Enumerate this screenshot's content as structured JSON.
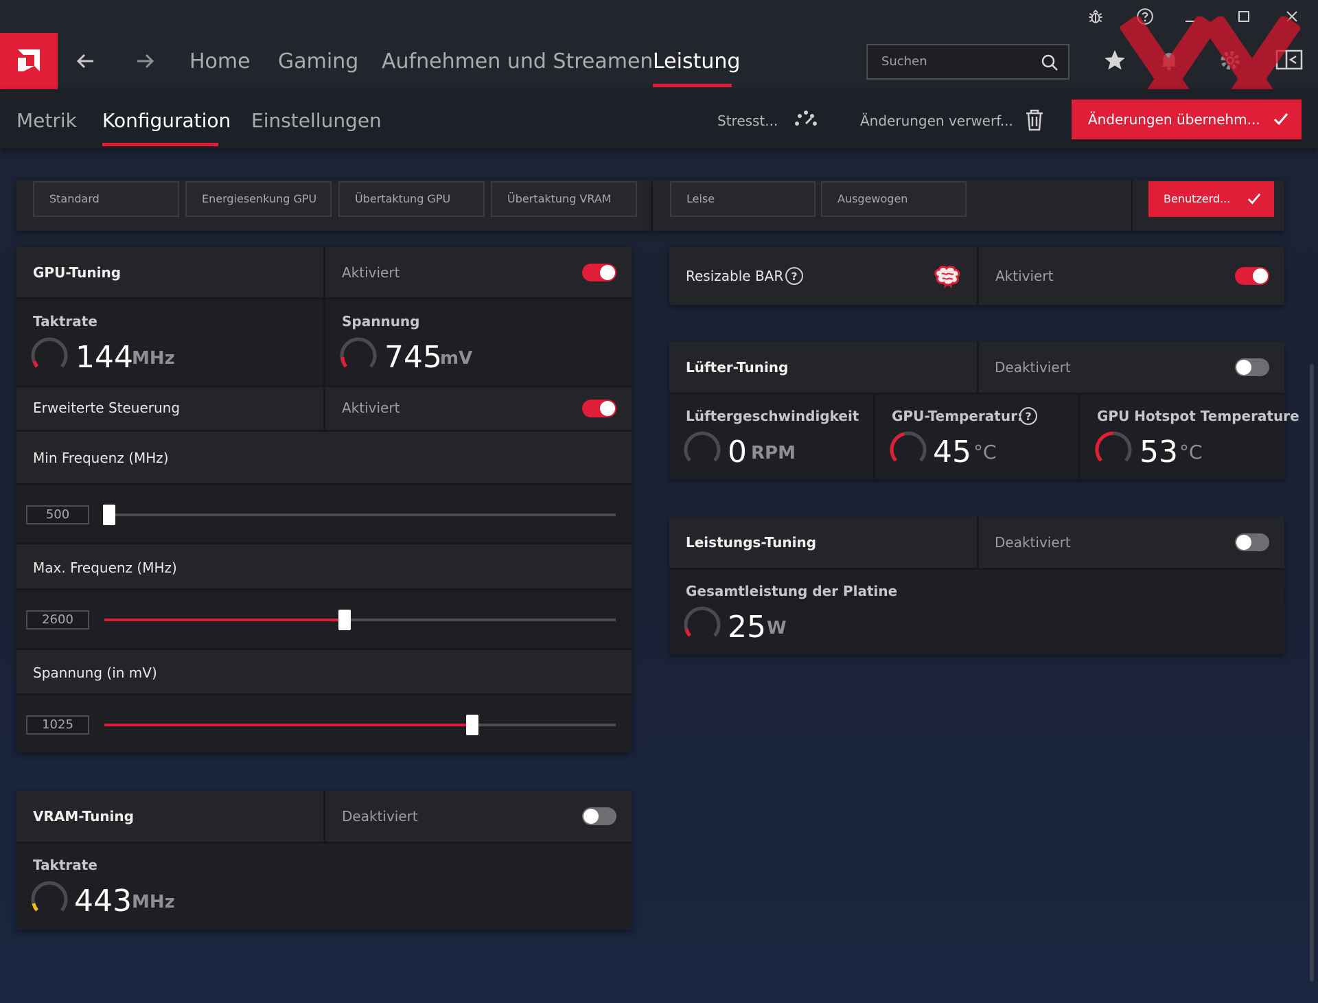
{
  "nav": {
    "home": "Home",
    "gaming": "Gaming",
    "record": "Aufnehmen und Streamen",
    "performance": "Leistung",
    "search_placeholder": "Suchen"
  },
  "subnav": {
    "metrics": "Metrik",
    "config": "Konfiguration",
    "settings": "Einstellungen",
    "stress": "Stresst...",
    "discard": "Änderungen verwerf...",
    "apply": "Änderungen übernehm..."
  },
  "presets": {
    "tuning": [
      "Standard",
      "Energiesenkung GPU",
      "Übertaktung GPU",
      "Übertaktung VRAM"
    ],
    "fan": [
      "Leise",
      "Ausgewogen"
    ],
    "custom": "Benutzerd..."
  },
  "gpu_tuning": {
    "title": "GPU-Tuning",
    "state": "Aktiviert",
    "clock_label": "Taktrate",
    "clock_value": "144",
    "clock_unit": "MHz",
    "voltage_label": "Spannung",
    "voltage_value": "745",
    "voltage_unit": "mV",
    "advanced_label": "Erweiterte Steuerung",
    "advanced_state": "Aktiviert",
    "min_freq_label": "Min Frequenz (MHz)",
    "min_freq_value": "500",
    "min_freq_level": 0.01,
    "max_freq_label": "Max. Frequenz (MHz)",
    "max_freq_value": "2600",
    "max_freq_level": 0.47,
    "voltage_setting_label": "Spannung (in mV)",
    "voltage_setting_value": "1025",
    "voltage_setting_level": 0.72
  },
  "vram_tuning": {
    "title": "VRAM-Tuning",
    "state": "Deaktiviert",
    "clock_label": "Taktrate",
    "clock_value": "443",
    "clock_unit": "MHz"
  },
  "resizable_bar": {
    "title": "Resizable BAR",
    "state": "Aktiviert"
  },
  "fan_tuning": {
    "title": "Lüfter-Tuning",
    "state": "Deaktiviert",
    "speed_label": "Lüftergeschwindigkeit",
    "speed_value": "0",
    "speed_unit": "RPM",
    "temp_label": "GPU-Temperatur:",
    "temp_value": "45",
    "temp_unit": "°C",
    "hotspot_label": "GPU Hotspot Temperature",
    "hotspot_value": "53",
    "hotspot_unit": "°C"
  },
  "power_tuning": {
    "title": "Leistungs-Tuning",
    "state": "Deaktiviert",
    "board_power_label": "Gesamtleistung der Platine",
    "board_power_value": "25",
    "board_power_unit": "W"
  },
  "colors": {
    "accent": "#e01e37",
    "gauge_yellow": "#f2b81c"
  }
}
